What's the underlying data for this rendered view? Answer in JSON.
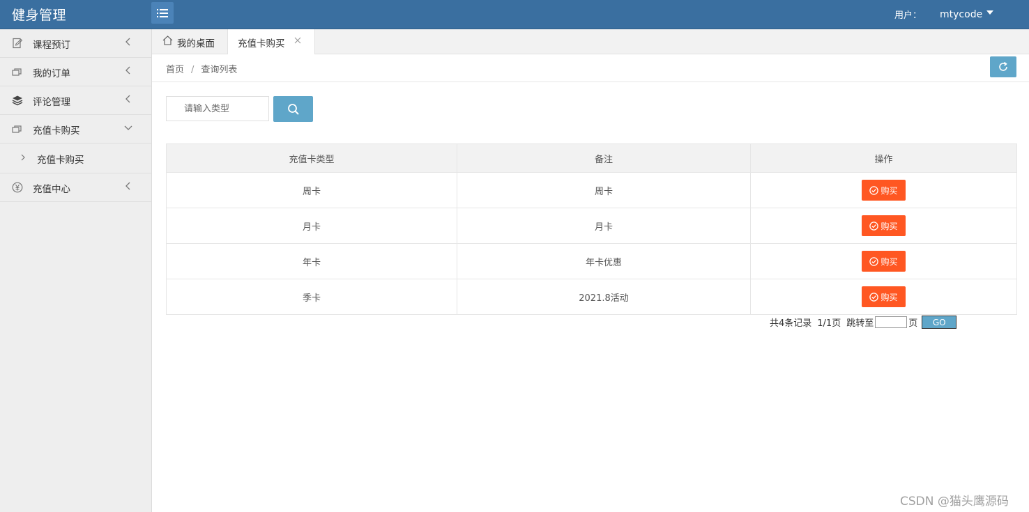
{
  "header": {
    "app_title": "健身管理",
    "user_label": "用户：",
    "username": "mtycode"
  },
  "sidebar": {
    "items": [
      {
        "label": "课程预订",
        "icon": "edit-note-icon"
      },
      {
        "label": "我的订单",
        "icon": "cards-icon"
      },
      {
        "label": "评论管理",
        "icon": "layers-icon"
      },
      {
        "label": "充值卡购买",
        "icon": "cards-icon",
        "expanded": true,
        "children": [
          {
            "label": "充值卡购买"
          }
        ]
      },
      {
        "label": "充值中心",
        "icon": "yen-circle-icon"
      }
    ]
  },
  "tabs": {
    "home": "我的桌面",
    "active": "充值卡购买"
  },
  "breadcrumb": {
    "home": "首页",
    "separator": "/",
    "current": "查询列表"
  },
  "search": {
    "placeholder": "请输入类型"
  },
  "table": {
    "headers": [
      "充值卡类型",
      "备注",
      "操作"
    ],
    "rows": [
      {
        "type": "周卡",
        "note": "周卡",
        "action": "购买"
      },
      {
        "type": "月卡",
        "note": "月卡",
        "action": "购买"
      },
      {
        "type": "年卡",
        "note": "年卡优惠",
        "action": "购买"
      },
      {
        "type": "季卡",
        "note": "2021.8活动",
        "action": "购买"
      }
    ]
  },
  "pager": {
    "total": "共4条记录",
    "pages": "1/1页",
    "jump_label": "跳转至",
    "page_unit": "页",
    "go": "GO"
  },
  "watermark": "CSDN @猫头鹰源码",
  "colors": {
    "header": "#3a6fa0",
    "accent": "#5fa6c9",
    "buy": "#ff5722"
  }
}
